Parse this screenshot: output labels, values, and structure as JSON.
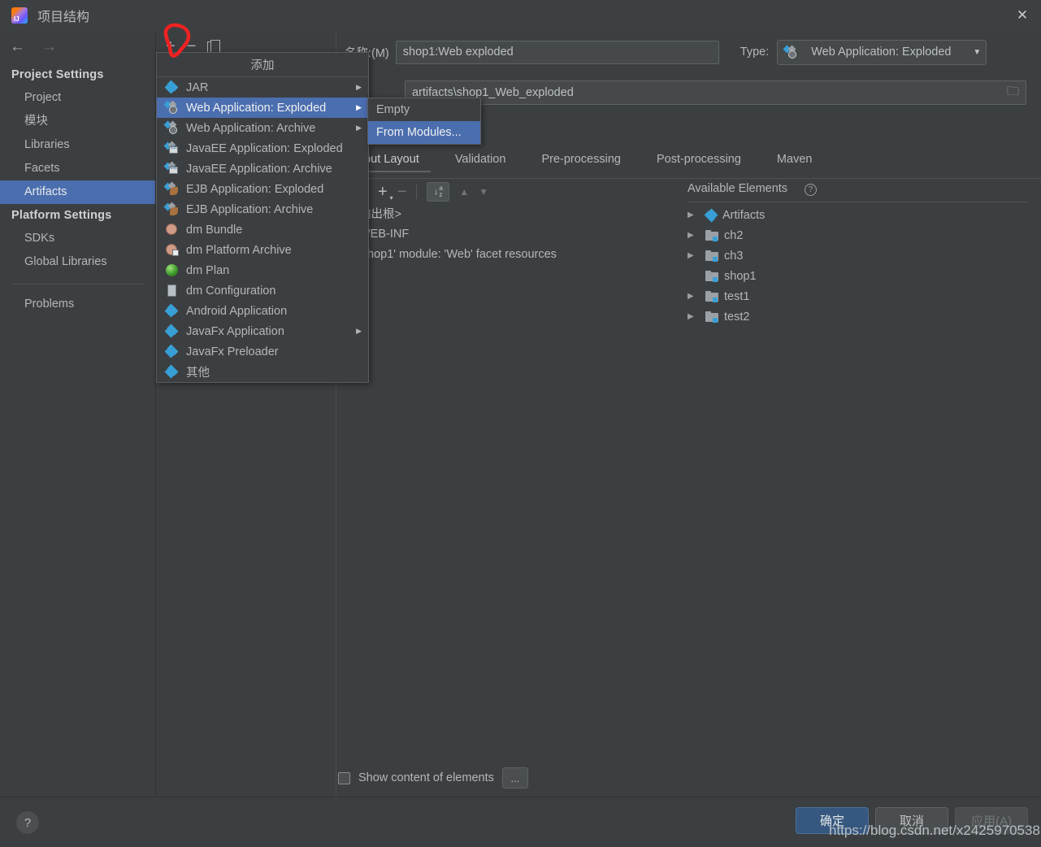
{
  "window": {
    "title": "项目结构",
    "logo_icon": "intellij-idea-logo",
    "close_icon": "✕"
  },
  "nav": {
    "back_icon": "←",
    "forward_icon": "→"
  },
  "sidebar": {
    "groups": [
      {
        "title": "Project Settings",
        "items": [
          {
            "label": "Project",
            "selected": false
          },
          {
            "label": "模块",
            "selected": false
          },
          {
            "label": "Libraries",
            "selected": false
          },
          {
            "label": "Facets",
            "selected": false
          },
          {
            "label": "Artifacts",
            "selected": true
          }
        ]
      },
      {
        "title": "Platform Settings",
        "items": [
          {
            "label": "SDKs",
            "selected": false
          },
          {
            "label": "Global Libraries",
            "selected": false
          }
        ]
      }
    ],
    "problems_label": "Problems"
  },
  "toolbar": {
    "add_icon": "+",
    "remove_icon": "−",
    "copy_icon": "copy-icon"
  },
  "artifact": {
    "name_label": "名称:(M)",
    "name_label_plain": ":(",
    "name_value": "shop1:Web exploded",
    "type_label": "Type:",
    "type_value": "Web Application: Exploded",
    "type_icon": "web-application-icon",
    "caret_icon": "▼",
    "output_path": "artifacts\\shop1_Web_exploded",
    "folder_icon": "📂"
  },
  "tabs": [
    {
      "label": "utput Layout",
      "active": true
    },
    {
      "label": "Validation",
      "active": false
    },
    {
      "label": "Pre-processing",
      "active": false
    },
    {
      "label": "Post-processing",
      "active": false
    },
    {
      "label": "Maven",
      "active": false
    }
  ],
  "layout_toolbar": {
    "stripe_icon": "columns-icon",
    "add_icon": "+",
    "add_caret": "▾",
    "remove_icon": "−",
    "sort_icon_top": "a",
    "sort_icon_bottom": "z",
    "sort_arrow": "↓",
    "move_up_icon": "▲",
    "move_down_icon": "▼"
  },
  "output_tree": {
    "rows": [
      {
        "label": "输出根>",
        "glyph": ""
      },
      {
        "label": "WEB-INF",
        "glyph": ""
      },
      {
        "label": "'shop1' module: 'Web' facet resources",
        "glyph": ""
      }
    ]
  },
  "available_elements": {
    "title": "Available Elements",
    "help_icon": "?",
    "items": [
      {
        "label": "Artifacts",
        "icon": "artifacts-diamond-icon",
        "expandable": true
      },
      {
        "label": "ch2",
        "icon": "module-icon",
        "expandable": true
      },
      {
        "label": "ch3",
        "icon": "module-icon",
        "expandable": true
      },
      {
        "label": "shop1",
        "icon": "module-icon",
        "expandable": false
      },
      {
        "label": "test1",
        "icon": "module-icon",
        "expandable": true
      },
      {
        "label": "test2",
        "icon": "module-icon",
        "expandable": true
      }
    ],
    "expand_arrow": "▶"
  },
  "bottom": {
    "show_content_label": "Show content of elements",
    "show_content_checked": false,
    "ellipsis_label": "..."
  },
  "footer": {
    "help_icon": "?",
    "ok_label": "确定",
    "cancel_label": "取消",
    "apply_label": "应用(A)",
    "apply_enabled": false
  },
  "watermark": "https://blog.csdn.net/x2425970538",
  "popup_menu": {
    "header": "添加",
    "items": [
      {
        "label": "JAR",
        "icon": "jar-icon",
        "icon_class": "i-jar",
        "submenu": true,
        "selected": false
      },
      {
        "label": "Web Application: Exploded",
        "icon": "web-application-icon",
        "icon_class": "i-web",
        "submenu": true,
        "selected": true
      },
      {
        "label": "Web Application: Archive",
        "icon": "web-application-icon",
        "icon_class": "i-web",
        "submenu": true,
        "selected": false
      },
      {
        "label": "JavaEE Application: Exploded",
        "icon": "javaee-application-icon",
        "icon_class": "i-jee",
        "submenu": false,
        "selected": false
      },
      {
        "label": "JavaEE Application: Archive",
        "icon": "javaee-application-icon",
        "icon_class": "i-jee",
        "submenu": false,
        "selected": false
      },
      {
        "label": "EJB Application: Exploded",
        "icon": "ejb-application-icon",
        "icon_class": "i-ejb",
        "submenu": false,
        "selected": false
      },
      {
        "label": "EJB Application: Archive",
        "icon": "ejb-application-icon",
        "icon_class": "i-ejb",
        "submenu": false,
        "selected": false
      },
      {
        "label": "dm Bundle",
        "icon": "dm-bundle-icon",
        "icon_class": "i-dm plain",
        "submenu": false,
        "selected": false
      },
      {
        "label": "dm Platform Archive",
        "icon": "dm-platform-archive-icon",
        "icon_class": "i-dm",
        "submenu": false,
        "selected": false
      },
      {
        "label": "dm Plan",
        "icon": "dm-plan-icon",
        "icon_class": "i-plan",
        "submenu": false,
        "selected": false
      },
      {
        "label": "dm Configuration",
        "icon": "dm-configuration-icon",
        "icon_class": "i-cfg",
        "submenu": false,
        "selected": false
      },
      {
        "label": "Android Application",
        "icon": "android-application-icon",
        "icon_class": "i-jar",
        "submenu": false,
        "selected": false
      },
      {
        "label": "JavaFx Application",
        "icon": "javafx-application-icon",
        "icon_class": "i-jar",
        "submenu": true,
        "selected": false
      },
      {
        "label": "JavaFx Preloader",
        "icon": "javafx-preloader-icon",
        "icon_class": "i-jar",
        "submenu": false,
        "selected": false
      },
      {
        "label": "其他",
        "icon": "other-icon",
        "icon_class": "i-jar",
        "submenu": false,
        "selected": false
      }
    ],
    "submenu_arrow": "▶"
  },
  "submenu": {
    "items": [
      {
        "label": "Empty",
        "selected": false
      },
      {
        "label": "From Modules...",
        "selected": true
      }
    ]
  },
  "annotation": {
    "type": "hand-drawn-red-circle",
    "color": "#ee2222",
    "target": "add-button"
  },
  "colors": {
    "background": "#3c3f41",
    "titlebar": "#3c4043",
    "selection_blue": "#4b6eaf",
    "primary_button": "#365880",
    "accent_icon_blue": "#389fd6",
    "annotation_red": "#ee2222"
  }
}
